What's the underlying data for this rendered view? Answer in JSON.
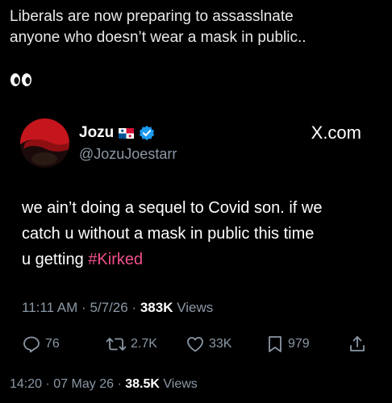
{
  "outer_post": {
    "text_line1": "Liberals are now preparing to assasslnate",
    "text_line2": "anyone who doesn’t wear a mask in public..",
    "emoji": "eyes-emoji"
  },
  "quoted_post": {
    "display_name": "Jozu",
    "handle": "@JozuJoestarr",
    "flag": "panama-flag",
    "verified_icon": "verified-badge-icon",
    "source": "X.com",
    "body_line1": "we ain’t doing a sequel to Covid son. if we",
    "body_line2": "catch u without a mask in public this time",
    "body_line3_prefix": "u getting ",
    "hashtag": "#Kirked",
    "time": "11:11 AM",
    "date": "5/7/26",
    "views_count": "383K",
    "views_label": "Views",
    "actions": {
      "replies": "76",
      "reposts": "2.7K",
      "likes": "33K",
      "bookmarks": "979"
    }
  },
  "footer": {
    "time": "14:20",
    "date": "07 May 26",
    "views_count": "38.5K",
    "views_label": "Views"
  },
  "colors": {
    "background": "#000000",
    "text": "#e7e9ea",
    "muted": "#8b98a5",
    "hashtag": "#f0508a",
    "verified": "#1d9bf0"
  }
}
